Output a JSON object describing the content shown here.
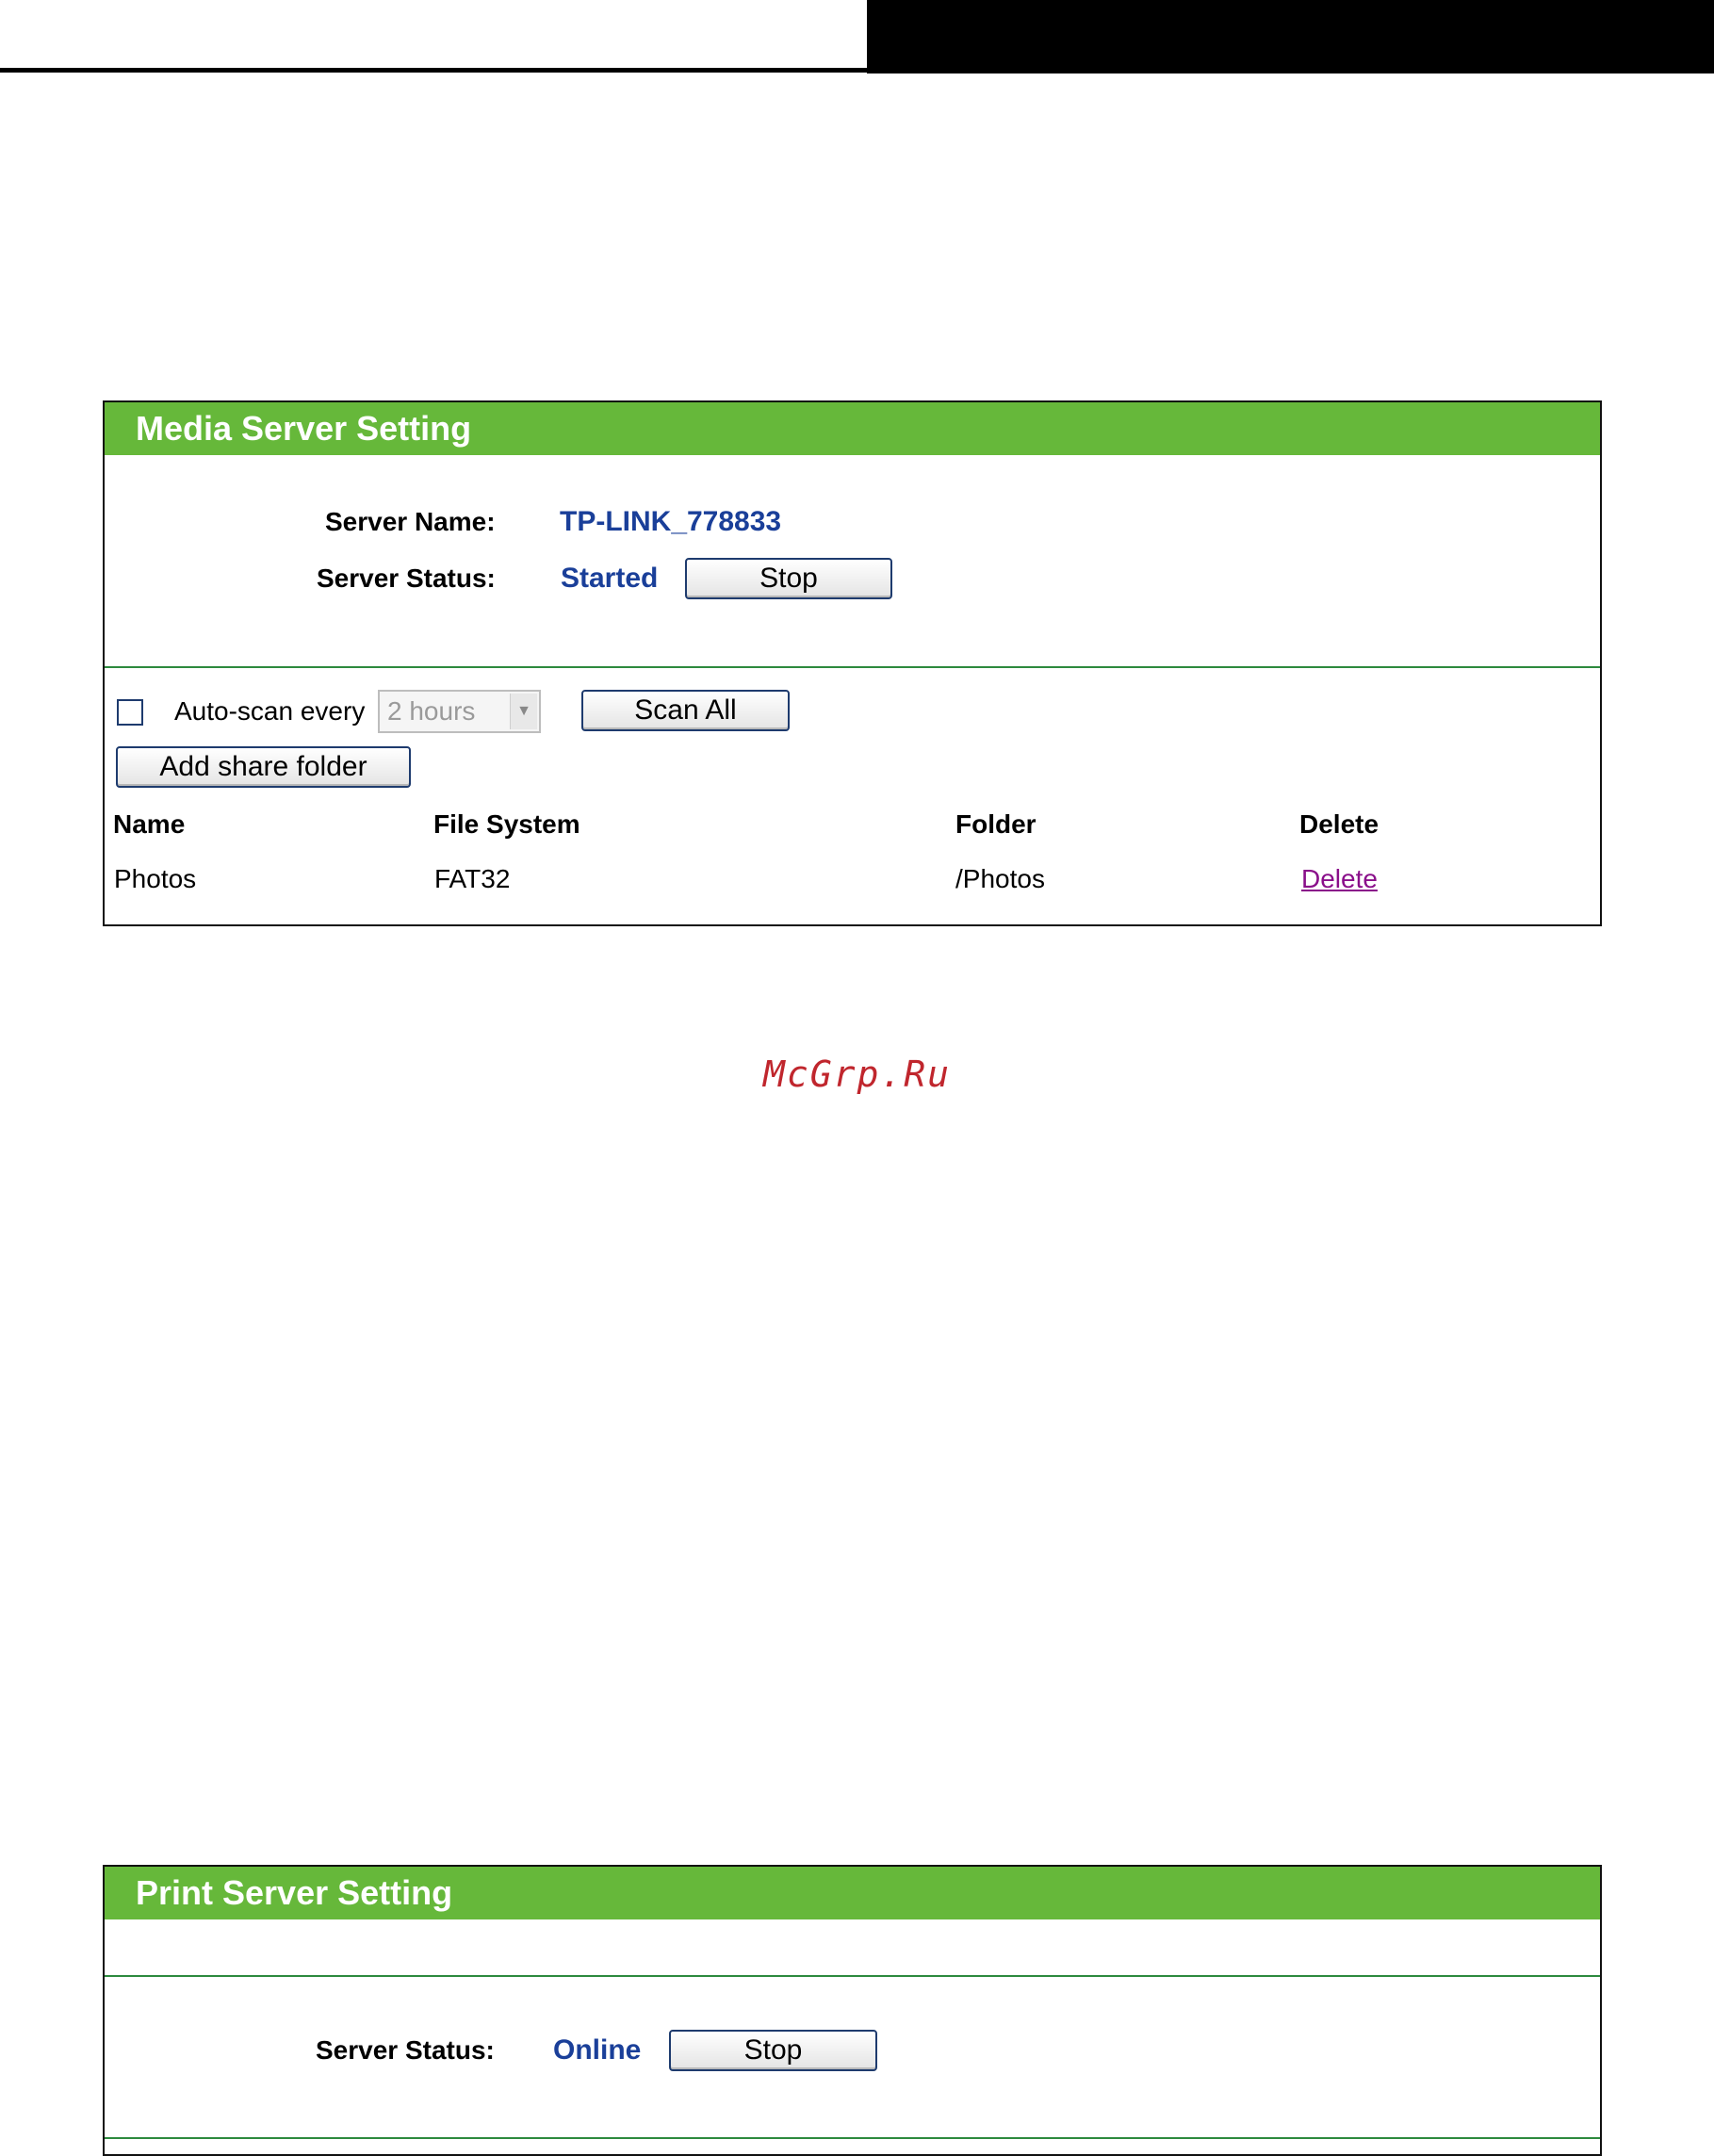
{
  "watermark": "McGrp.Ru",
  "media_server": {
    "title": "Media Server Setting",
    "server_name_label": "Server Name:",
    "server_name_value": "TP-LINK_778833",
    "server_status_label": "Server Status:",
    "server_status_value": "Started",
    "stop_button": "Stop",
    "auto_scan_checked": false,
    "auto_scan_label": "Auto-scan every",
    "auto_scan_interval": "2 hours",
    "scan_all_button": "Scan All",
    "add_share_folder_button": "Add share folder",
    "table": {
      "headers": [
        "Name",
        "File System",
        "Folder",
        "Delete"
      ],
      "rows": [
        {
          "name": "Photos",
          "file_system": "FAT32",
          "folder": "/Photos",
          "delete": "Delete"
        }
      ]
    }
  },
  "print_server": {
    "title": "Print Server Setting",
    "server_status_label": "Server Status:",
    "server_status_value": "Online",
    "stop_button": "Stop"
  },
  "colors": {
    "panel_header": "#66b83a",
    "value_blue": "#1a3f99",
    "link_purple": "#8a0f8a",
    "watermark_red": "#c0262d"
  }
}
